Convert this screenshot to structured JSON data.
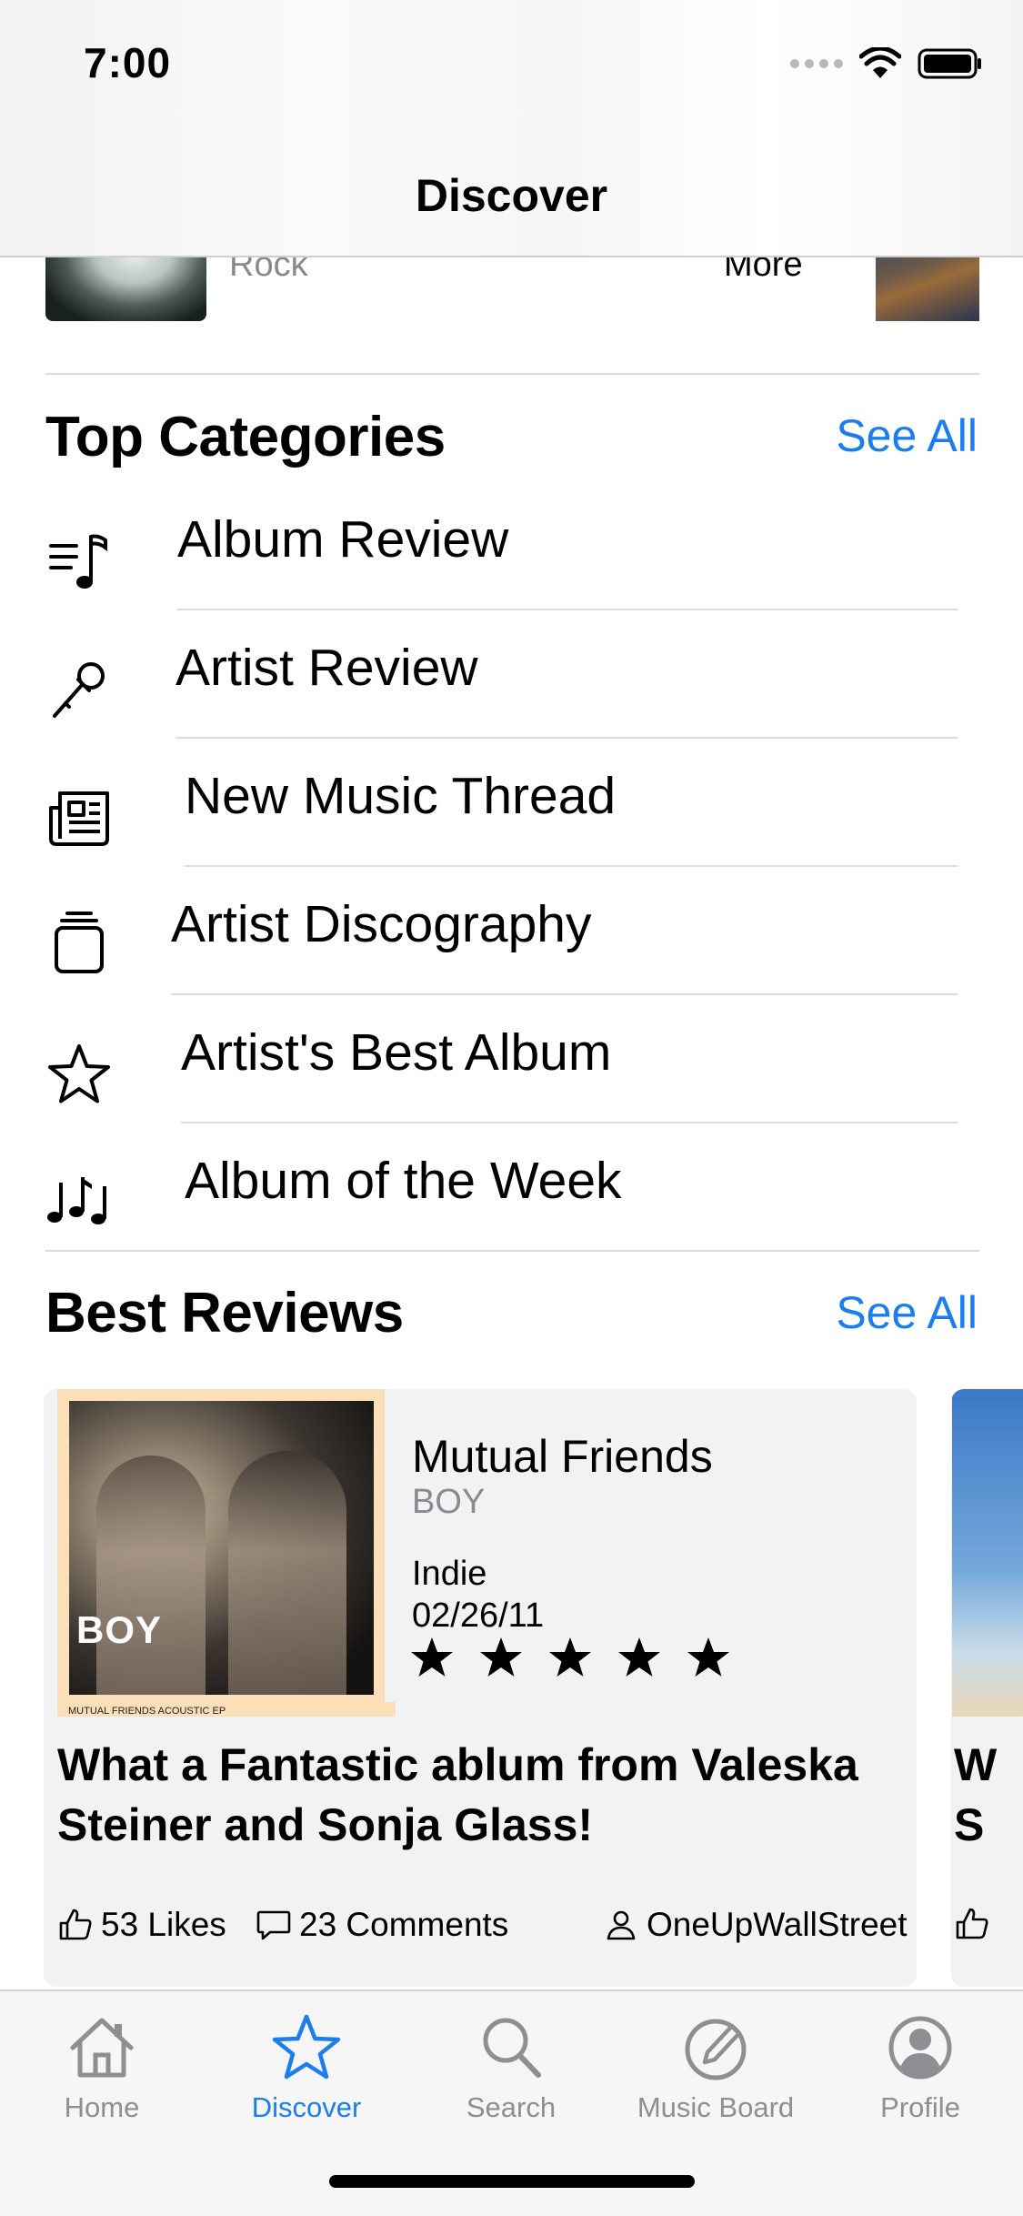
{
  "status_bar": {
    "time": "7:00"
  },
  "nav": {
    "title": "Discover"
  },
  "featured": {
    "genre": "Rock",
    "more_label": "More"
  },
  "top_categories": {
    "title": "Top Categories",
    "see_all": "See All",
    "items": [
      {
        "label": "Album Review",
        "icon": "music-list-icon"
      },
      {
        "label": "Artist Review",
        "icon": "microphone-icon"
      },
      {
        "label": "New Music Thread",
        "icon": "newspaper-icon"
      },
      {
        "label": "Artist Discography",
        "icon": "stack-icon"
      },
      {
        "label": "Artist's Best Album",
        "icon": "star-icon"
      },
      {
        "label": "Album of the Week",
        "icon": "music-notes-icon"
      }
    ]
  },
  "best_reviews": {
    "title": "Best Reviews",
    "see_all": "See All",
    "card": {
      "cover_text": "BOY",
      "cover_subtext": "MUTUAL FRIENDS ACOUSTIC EP",
      "album": "Mutual Friends",
      "artist": "BOY",
      "genre": "Indie",
      "date": "02/26/11",
      "rating": 5,
      "headline": "What a Fantastic ablum from Valeska Steiner and Sonja Glass!",
      "likes": "53 Likes",
      "comments": "23 Comments",
      "author": "OneUpWallStreet"
    },
    "next_card_letters": "W\nS"
  },
  "tabbar": {
    "items": [
      {
        "label": "Home",
        "icon": "home-icon"
      },
      {
        "label": "Discover",
        "icon": "star-icon",
        "active": true
      },
      {
        "label": "Search",
        "icon": "search-icon"
      },
      {
        "label": "Music Board",
        "icon": "compose-icon"
      },
      {
        "label": "Profile",
        "icon": "profile-icon"
      }
    ]
  },
  "colors": {
    "accent": "#1a7ef0",
    "secondary_text": "#8a8a8e",
    "card_bg": "#f1f2f4"
  }
}
